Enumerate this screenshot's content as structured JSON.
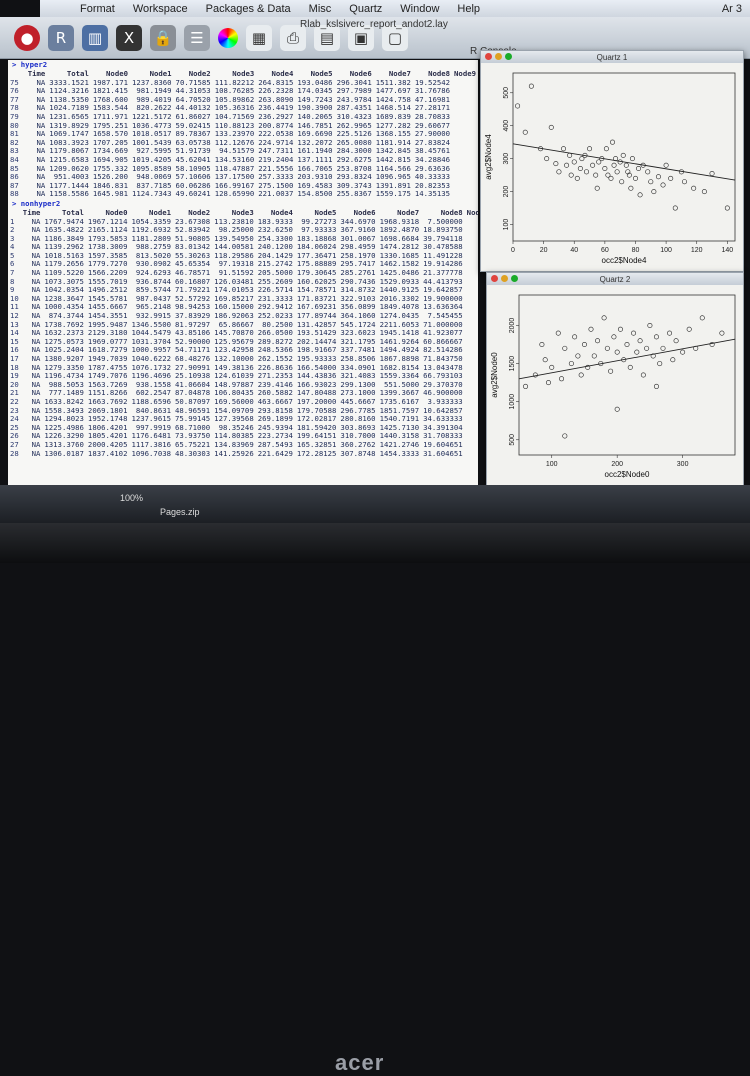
{
  "menubar": {
    "items": [
      "Format",
      "Workspace",
      "Packages & Data",
      "Misc",
      "Quartz",
      "Window",
      "Help"
    ],
    "clock": "Ar 3"
  },
  "window": {
    "title": "Rlab_kslsiverc_report_andot2.lay",
    "console_label": "R Console"
  },
  "toolbar": {
    "icons": [
      "stop-icon",
      "r-logo-icon",
      "chart-icon",
      "x11-icon",
      "lock-icon",
      "options-icon",
      "color-wheel-icon",
      "grid-icon",
      "print-icon",
      "new-document-icon",
      "open-document-icon",
      "save-icon"
    ]
  },
  "console": {
    "prompt1": "> hyper2",
    "prompt2": "> nonhyper2",
    "header": [
      "",
      "Time",
      "Total",
      "Node0",
      "Node1",
      "Node2",
      "Node3",
      "Node4",
      "Node5",
      "Node6",
      "Node7",
      "Node8",
      "Node9"
    ],
    "block1": [
      [
        "75",
        "NA",
        "3333.1521",
        "1987.171",
        "1237.8360",
        "70.71585",
        "111.82212",
        "264.8315",
        "193.0486",
        "296.3041",
        "1511.382",
        "19.52542"
      ],
      [
        "76",
        "NA",
        "1124.3216",
        "1821.415",
        "981.1949",
        "44.31053",
        "108.76285",
        "226.2328",
        "174.0345",
        "297.7989",
        "1477.697",
        "31.76786"
      ],
      [
        "77",
        "NA",
        "1138.5350",
        "1768.600",
        "989.4019",
        "64.70520",
        "105.89862",
        "263.8090",
        "149.7243",
        "243.9784",
        "1424.758",
        "47.16981"
      ],
      [
        "78",
        "NA",
        "1024.7189",
        "1583.544",
        "820.2622",
        "44.40132",
        "105.36316",
        "236.4419",
        "190.3900",
        "287.4351",
        "1468.514",
        "27.28171"
      ],
      [
        "79",
        "NA",
        "1231.6565",
        "1711.971",
        "1221.5172",
        "61.86027",
        "104.71569",
        "236.2927",
        "140.2065",
        "310.4323",
        "1689.839",
        "28.70833"
      ],
      [
        "80",
        "NA",
        "1319.8929",
        "1795.251",
        "1036.4773",
        "59.02415",
        "110.88123",
        "200.8774",
        "146.7851",
        "262.9965",
        "1277.282",
        "29.60677"
      ],
      [
        "81",
        "NA",
        "1069.1747",
        "1658.570",
        "1018.0517",
        "89.78367",
        "133.23970",
        "222.0538",
        "169.6690",
        "225.5126",
        "1368.155",
        "27.90000"
      ],
      [
        "82",
        "NA",
        "1083.3923",
        "1707.205",
        "1001.5439",
        "63.05738",
        "112.12676",
        "224.9714",
        "132.2072",
        "265.0080",
        "1181.914",
        "27.83824"
      ],
      [
        "83",
        "NA",
        "1179.8067",
        "1734.669",
        "927.5995",
        "51.91739",
        "94.51579",
        "247.7311",
        "161.1940",
        "284.3000",
        "1342.845",
        "38.45761"
      ],
      [
        "84",
        "NA",
        "1215.6583",
        "1694.905",
        "1019.4205",
        "45.62041",
        "134.53160",
        "219.2404",
        "137.1111",
        "292.6275",
        "1442.815",
        "34.28846"
      ],
      [
        "85",
        "NA",
        "1209.0620",
        "1755.332",
        "1095.8589",
        "58.10905",
        "118.47887",
        "221.5556",
        "166.7065",
        "253.8708",
        "1164.566",
        "29.63636"
      ],
      [
        "86",
        "NA",
        "951.4003",
        "1526.200",
        "948.0069",
        "57.10606",
        "137.17500",
        "257.3333",
        "203.9310",
        "293.8324",
        "1096.965",
        "40.33333"
      ],
      [
        "87",
        "NA",
        "1177.1444",
        "1846.831",
        "837.7185",
        "60.06286",
        "166.99167",
        "275.1500",
        "169.4583",
        "309.3743",
        "1391.891",
        "20.82353"
      ],
      [
        "88",
        "NA",
        "1158.5586",
        "1645.981",
        "1124.7343",
        "49.60241",
        "128.65990",
        "221.0037",
        "154.8500",
        "255.8367",
        "1559.175",
        "14.35135"
      ]
    ],
    "block2": [
      [
        "1",
        "NA",
        "1767.9474",
        "1967.1214",
        "1054.3359",
        "23.67308",
        "113.23810",
        "183.9333",
        "99.27273",
        "344.6970",
        "1968.9318",
        "7.500000"
      ],
      [
        "2",
        "NA",
        "1635.4822",
        "2165.1124",
        "1192.6932",
        "52.83942",
        "98.25000",
        "232.6250",
        "97.93333",
        "367.9160",
        "1892.4870",
        "18.893750"
      ],
      [
        "3",
        "NA",
        "1186.3849",
        "1793.5853",
        "1181.2809",
        "51.90805",
        "139.54950",
        "254.3300",
        "183.18868",
        "301.0067",
        "1698.6684",
        "39.794118"
      ],
      [
        "4",
        "NA",
        "1139.2962",
        "1738.3009",
        "988.2759",
        "83.01342",
        "144.00581",
        "240.1200",
        "184.06024",
        "298.4959",
        "1474.2812",
        "30.478588"
      ],
      [
        "5",
        "NA",
        "1018.5163",
        "1597.3585",
        "813.5020",
        "55.30263",
        "118.29586",
        "204.1429",
        "177.36471",
        "258.1970",
        "1330.1685",
        "11.491228"
      ],
      [
        "6",
        "NA",
        "1179.2656",
        "1779.7270",
        "930.0902",
        "45.65354",
        "97.19318",
        "215.2742",
        "175.88889",
        "295.7417",
        "1462.1582",
        "19.914286"
      ],
      [
        "7",
        "NA",
        "1109.5220",
        "1566.2209",
        "924.6293",
        "46.78571",
        "91.51592",
        "205.5000",
        "179.30645",
        "285.2761",
        "1425.0486",
        "21.377778"
      ],
      [
        "8",
        "NA",
        "1073.3075",
        "1555.7019",
        "936.8744",
        "60.16807",
        "126.03481",
        "255.2609",
        "160.62025",
        "290.7436",
        "1529.0933",
        "44.413793"
      ],
      [
        "9",
        "NA",
        "1042.0354",
        "1496.2512",
        "859.5744",
        "71.79221",
        "174.01053",
        "226.5714",
        "154.78571",
        "314.8732",
        "1440.9125",
        "19.642857"
      ],
      [
        "10",
        "NA",
        "1238.3647",
        "1545.5781",
        "987.0437",
        "52.57292",
        "169.85217",
        "231.3333",
        "171.83721",
        "322.9103",
        "2016.3302",
        "19.900000"
      ],
      [
        "11",
        "NA",
        "1000.4354",
        "1455.6667",
        "965.2148",
        "98.94253",
        "160.15000",
        "292.9412",
        "167.69231",
        "356.0899",
        "1849.4078",
        "13.636364"
      ],
      [
        "12",
        "NA",
        "874.3744",
        "1454.3551",
        "932.9915",
        "37.83929",
        "186.92063",
        "252.0233",
        "177.89744",
        "364.1060",
        "1274.0435",
        "7.545455"
      ],
      [
        "13",
        "NA",
        "1738.7692",
        "1995.9487",
        "1346.5500",
        "81.97297",
        "65.86667",
        "80.2500",
        "131.42857",
        "545.1724",
        "2211.6053",
        "71.000000"
      ],
      [
        "14",
        "NA",
        "1632.2373",
        "2129.3180",
        "1044.5479",
        "43.85106",
        "145.70870",
        "266.0500",
        "193.51429",
        "323.6023",
        "1945.1418",
        "41.923077"
      ],
      [
        "15",
        "NA",
        "1275.0573",
        "1969.0777",
        "1031.3704",
        "52.90000",
        "125.95679",
        "289.8272",
        "202.14474",
        "321.1795",
        "1461.9264",
        "60.866667"
      ],
      [
        "16",
        "NA",
        "1025.2404",
        "1618.7279",
        "1000.9957",
        "54.71171",
        "123.42958",
        "248.5366",
        "198.91667",
        "337.7481",
        "1494.4924",
        "82.514286"
      ],
      [
        "17",
        "NA",
        "1380.9207",
        "1949.7039",
        "1040.6222",
        "68.48276",
        "132.10000",
        "262.1552",
        "195.93333",
        "258.8506",
        "1867.8898",
        "71.843750"
      ],
      [
        "18",
        "NA",
        "1279.3350",
        "1787.4755",
        "1076.1732",
        "27.90991",
        "149.38136",
        "226.8636",
        "166.54000",
        "334.0901",
        "1682.8154",
        "13.043478"
      ],
      [
        "19",
        "NA",
        "1196.4734",
        "1749.7076",
        "1196.4696",
        "25.10938",
        "124.61039",
        "271.2353",
        "144.43836",
        "321.4083",
        "1559.3364",
        "66.793103"
      ],
      [
        "20",
        "NA",
        "988.5053",
        "1563.7269",
        "938.1558",
        "41.06604",
        "148.97887",
        "239.4146",
        "166.93023",
        "299.1300",
        "551.5000",
        "29.370370"
      ],
      [
        "21",
        "NA",
        "777.1489",
        "1151.8266",
        "602.2547",
        "87.04878",
        "106.80435",
        "260.5882",
        "147.80488",
        "273.1000",
        "1399.3667",
        "46.900000"
      ],
      [
        "22",
        "NA",
        "1633.8242",
        "1663.7692",
        "1188.6596",
        "50.87097",
        "169.56000",
        "463.6667",
        "197.20000",
        "445.6667",
        "1735.6167",
        "3.933333"
      ],
      [
        "23",
        "NA",
        "1558.3493",
        "2069.1801",
        "840.8631",
        "48.96591",
        "154.09709",
        "293.8158",
        "179.70588",
        "296.7785",
        "1851.7597",
        "10.642857"
      ],
      [
        "24",
        "NA",
        "1294.8023",
        "1952.1748",
        "1237.9615",
        "75.99145",
        "127.39568",
        "269.1899",
        "172.02817",
        "280.8160",
        "1540.7191",
        "34.633333"
      ],
      [
        "25",
        "NA",
        "1225.4986",
        "1806.4201",
        "997.9919",
        "68.71000",
        "98.35246",
        "245.9394",
        "181.59420",
        "303.8693",
        "1425.7130",
        "34.391304"
      ],
      [
        "26",
        "NA",
        "1226.3290",
        "1805.4201",
        "1176.6481",
        "73.93750",
        "114.80385",
        "223.2734",
        "199.64151",
        "310.7000",
        "1440.3158",
        "31.708333"
      ],
      [
        "27",
        "NA",
        "1313.3760",
        "2000.4205",
        "1117.3816",
        "65.75221",
        "134.83969",
        "287.5493",
        "165.32851",
        "360.2762",
        "1421.2746",
        "19.604651"
      ],
      [
        "28",
        "NA",
        "1306.0187",
        "1837.4102",
        "1096.7038",
        "48.30303",
        "141.25926",
        "221.6429",
        "172.28125",
        "307.8748",
        "1454.3333",
        "31.604651"
      ]
    ]
  },
  "plots": {
    "quartz1": {
      "window_title": "Quartz 1",
      "xlabel": "occ2$Node4",
      "ylabel": "avg2$Node4",
      "xticks": [
        "0",
        "20",
        "40",
        "60",
        "80",
        "100",
        "120",
        "140"
      ],
      "yticks": [
        "100",
        "200",
        "300",
        "400",
        "500"
      ]
    },
    "quartz2": {
      "window_title": "Quartz 2",
      "xlabel": "occ2$Node0",
      "ylabel": "avg2$Node0",
      "xticks": [
        "100",
        "200",
        "300"
      ],
      "yticks": [
        "500",
        "1000",
        "1500",
        "2000"
      ]
    }
  },
  "chart_data": [
    {
      "type": "scatter",
      "xlabel": "occ2$Node4",
      "ylabel": "avg2$Node4",
      "xlim": [
        0,
        145
      ],
      "ylim": [
        50,
        560
      ],
      "trend_line": [
        [
          0,
          345
        ],
        [
          145,
          235
        ]
      ],
      "points": [
        [
          3,
          460
        ],
        [
          8,
          380
        ],
        [
          12,
          520
        ],
        [
          18,
          330
        ],
        [
          22,
          300
        ],
        [
          25,
          395
        ],
        [
          28,
          285
        ],
        [
          30,
          260
        ],
        [
          33,
          330
        ],
        [
          35,
          280
        ],
        [
          37,
          310
        ],
        [
          38,
          250
        ],
        [
          40,
          290
        ],
        [
          42,
          240
        ],
        [
          44,
          270
        ],
        [
          45,
          300
        ],
        [
          47,
          310
        ],
        [
          48,
          260
        ],
        [
          50,
          330
        ],
        [
          52,
          280
        ],
        [
          54,
          250
        ],
        [
          55,
          210
        ],
        [
          56,
          290
        ],
        [
          58,
          300
        ],
        [
          60,
          270
        ],
        [
          61,
          330
        ],
        [
          62,
          250
        ],
        [
          64,
          240
        ],
        [
          65,
          350
        ],
        [
          66,
          280
        ],
        [
          67,
          300
        ],
        [
          68,
          260
        ],
        [
          70,
          290
        ],
        [
          71,
          230
        ],
        [
          72,
          310
        ],
        [
          74,
          280
        ],
        [
          75,
          260
        ],
        [
          76,
          250
        ],
        [
          77,
          210
        ],
        [
          78,
          300
        ],
        [
          80,
          240
        ],
        [
          82,
          270
        ],
        [
          83,
          190
        ],
        [
          85,
          280
        ],
        [
          88,
          260
        ],
        [
          90,
          230
        ],
        [
          92,
          200
        ],
        [
          95,
          245
        ],
        [
          98,
          220
        ],
        [
          100,
          280
        ],
        [
          103,
          240
        ],
        [
          106,
          150
        ],
        [
          110,
          260
        ],
        [
          112,
          230
        ],
        [
          118,
          210
        ],
        [
          125,
          200
        ],
        [
          130,
          255
        ],
        [
          140,
          150
        ]
      ]
    },
    {
      "type": "scatter",
      "xlabel": "occ2$Node0",
      "ylabel": "avg2$Node0",
      "xlim": [
        50,
        380
      ],
      "ylim": [
        300,
        2400
      ],
      "trend_line": [
        [
          50,
          1300
        ],
        [
          380,
          1820
        ]
      ],
      "points": [
        [
          60,
          1200
        ],
        [
          75,
          1350
        ],
        [
          85,
          1750
        ],
        [
          90,
          1550
        ],
        [
          95,
          1250
        ],
        [
          100,
          1450
        ],
        [
          110,
          1900
        ],
        [
          115,
          1300
        ],
        [
          120,
          1700
        ],
        [
          130,
          1500
        ],
        [
          135,
          1850
        ],
        [
          140,
          1600
        ],
        [
          145,
          1350
        ],
        [
          150,
          1750
        ],
        [
          155,
          1450
        ],
        [
          160,
          1950
        ],
        [
          165,
          1600
        ],
        [
          170,
          1800
        ],
        [
          175,
          1500
        ],
        [
          180,
          2100
        ],
        [
          185,
          1700
        ],
        [
          190,
          1400
        ],
        [
          195,
          1850
        ],
        [
          200,
          1650
        ],
        [
          205,
          1950
        ],
        [
          210,
          1550
        ],
        [
          215,
          1750
        ],
        [
          220,
          1450
        ],
        [
          225,
          1900
        ],
        [
          230,
          1650
        ],
        [
          235,
          1800
        ],
        [
          240,
          1350
        ],
        [
          245,
          1700
        ],
        [
          250,
          2000
        ],
        [
          255,
          1600
        ],
        [
          260,
          1850
        ],
        [
          265,
          1500
        ],
        [
          270,
          1700
        ],
        [
          280,
          1900
        ],
        [
          285,
          1550
        ],
        [
          290,
          1800
        ],
        [
          300,
          1650
        ],
        [
          310,
          1950
        ],
        [
          320,
          1700
        ],
        [
          330,
          2100
        ],
        [
          345,
          1750
        ],
        [
          360,
          1900
        ],
        [
          120,
          550
        ],
        [
          200,
          900
        ],
        [
          260,
          1200
        ]
      ]
    }
  ],
  "dock": {
    "item1": "100%",
    "item2": "Pages.zip"
  },
  "bezel": {
    "brand": "acer"
  }
}
